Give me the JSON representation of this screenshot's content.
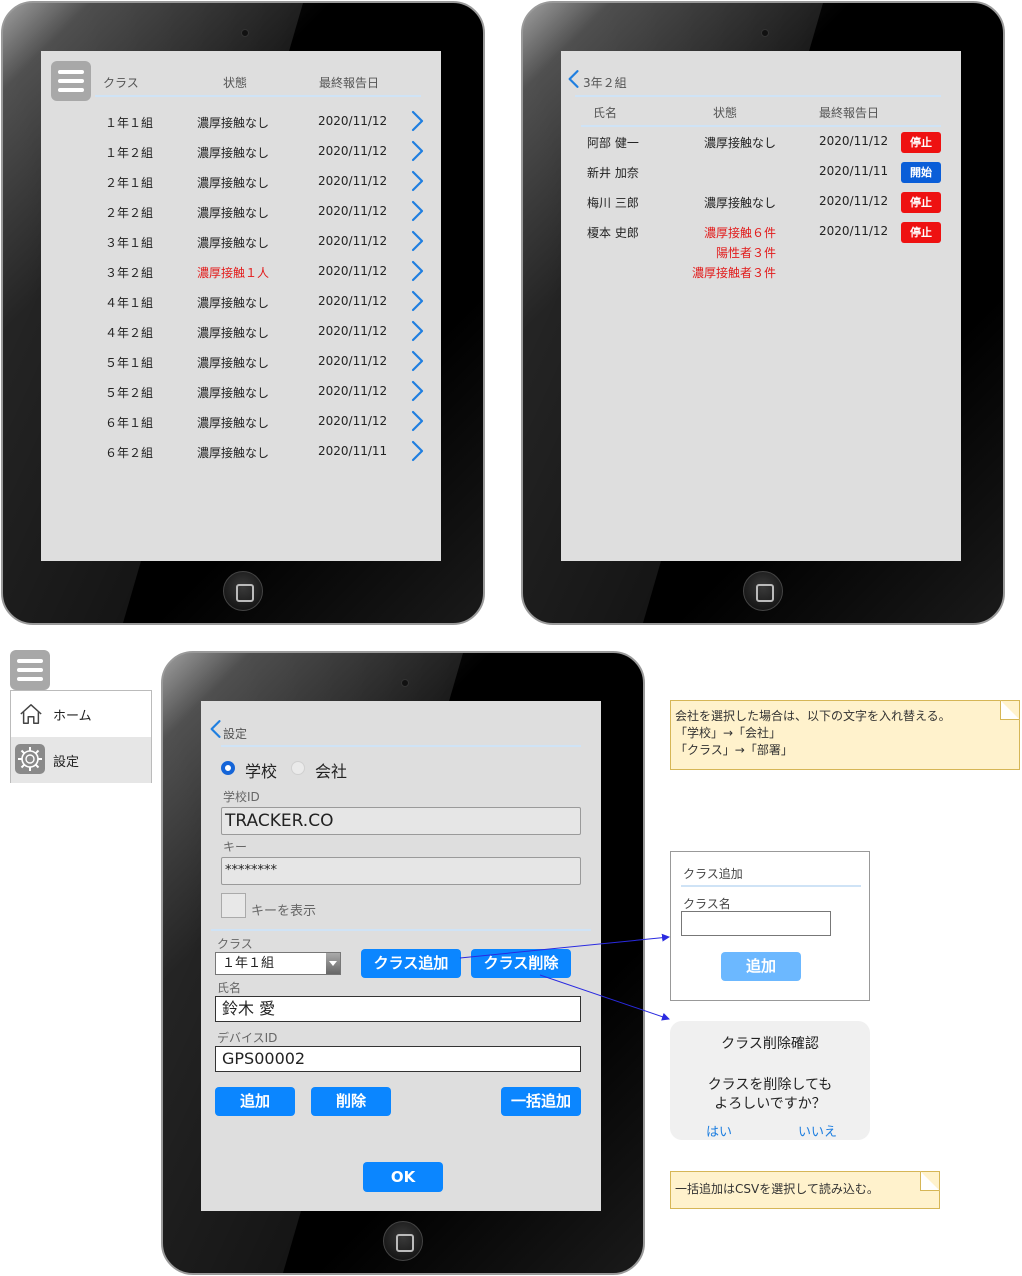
{
  "class_list": {
    "headers": {
      "class": "クラス",
      "status": "状態",
      "last_report": "最終報告日"
    },
    "rows": [
      {
        "class": "１年１組",
        "status": "濃厚接触なし",
        "date": "2020/11/12",
        "alert": false
      },
      {
        "class": "１年２組",
        "status": "濃厚接触なし",
        "date": "2020/11/12",
        "alert": false
      },
      {
        "class": "２年１組",
        "status": "濃厚接触なし",
        "date": "2020/11/12",
        "alert": false
      },
      {
        "class": "２年２組",
        "status": "濃厚接触なし",
        "date": "2020/11/12",
        "alert": false
      },
      {
        "class": "３年１組",
        "status": "濃厚接触なし",
        "date": "2020/11/12",
        "alert": false
      },
      {
        "class": "３年２組",
        "status": "濃厚接触１人",
        "date": "2020/11/12",
        "alert": true
      },
      {
        "class": "４年１組",
        "status": "濃厚接触なし",
        "date": "2020/11/12",
        "alert": false
      },
      {
        "class": "４年２組",
        "status": "濃厚接触なし",
        "date": "2020/11/12",
        "alert": false
      },
      {
        "class": "５年１組",
        "status": "濃厚接触なし",
        "date": "2020/11/12",
        "alert": false
      },
      {
        "class": "５年２組",
        "status": "濃厚接触なし",
        "date": "2020/11/12",
        "alert": false
      },
      {
        "class": "６年１組",
        "status": "濃厚接触なし",
        "date": "2020/11/12",
        "alert": false
      },
      {
        "class": "６年２組",
        "status": "濃厚接触なし",
        "date": "2020/11/11",
        "alert": false
      }
    ]
  },
  "class_detail": {
    "back_label": "3年２組",
    "headers": {
      "name": "氏名",
      "status": "状態",
      "last_report": "最終報告日"
    },
    "rows": [
      {
        "name": "阿部 健一",
        "status": [
          "濃厚接触なし"
        ],
        "alert": false,
        "date": "2020/11/12",
        "button": "停止",
        "button_color": "#ee1111"
      },
      {
        "name": "新井 加奈",
        "status": [],
        "alert": false,
        "date": "2020/11/11",
        "button": "開始",
        "button_color": "#0a5ed8"
      },
      {
        "name": "梅川 三郎",
        "status": [
          "濃厚接触なし"
        ],
        "alert": false,
        "date": "2020/11/12",
        "button": "停止",
        "button_color": "#ee1111"
      },
      {
        "name": "榎本 史郎",
        "status": [
          "濃厚接触６件",
          "陽性者３件",
          "濃厚接触者３件"
        ],
        "alert": true,
        "date": "2020/11/12",
        "button": "停止",
        "button_color": "#ee1111"
      }
    ]
  },
  "side_menu": {
    "home": "ホーム",
    "settings": "設定"
  },
  "settings": {
    "back_label": "設定",
    "radio_school": "学校",
    "radio_company": "会社",
    "school_id_label": "学校ID",
    "school_id_value": "TRACKER.CO",
    "key_label": "キー",
    "key_value": "********",
    "show_key_label": "キーを表示",
    "class_label": "クラス",
    "class_value": "１年１組",
    "add_class_button": "クラス追加",
    "delete_class_button": "クラス削除",
    "name_label": "氏名",
    "name_value": "鈴木 愛",
    "device_id_label": "デバイスID",
    "device_id_value": "GPS00002",
    "add_button": "追加",
    "delete_button": "削除",
    "bulk_add_button": "一括追加",
    "ok_button": "OK"
  },
  "notes": {
    "company_note": [
      "会社を選択した場合は、以下の文字を入れ替える。",
      "「学校」→「会社」",
      "「クラス」→「部署」"
    ],
    "bulk_note": "一括追加はCSVを選択して読み込む。"
  },
  "add_class_dialog": {
    "title": "クラス追加",
    "field_label": "クラス名",
    "field_value": "",
    "add_button": "追加"
  },
  "delete_confirm": {
    "title": "クラス削除確認",
    "message_line1": "クラスを削除しても",
    "message_line2": "よろしいですか？",
    "yes": "はい",
    "no": "いいえ"
  },
  "colors": {
    "accent_blue": "#0b86ff",
    "alert_red": "#e21b1b",
    "stop_red": "#ee1111",
    "start_blue": "#0a5ed8",
    "screen_gray": "#dedede",
    "note_yellow": "#fff2cc"
  }
}
